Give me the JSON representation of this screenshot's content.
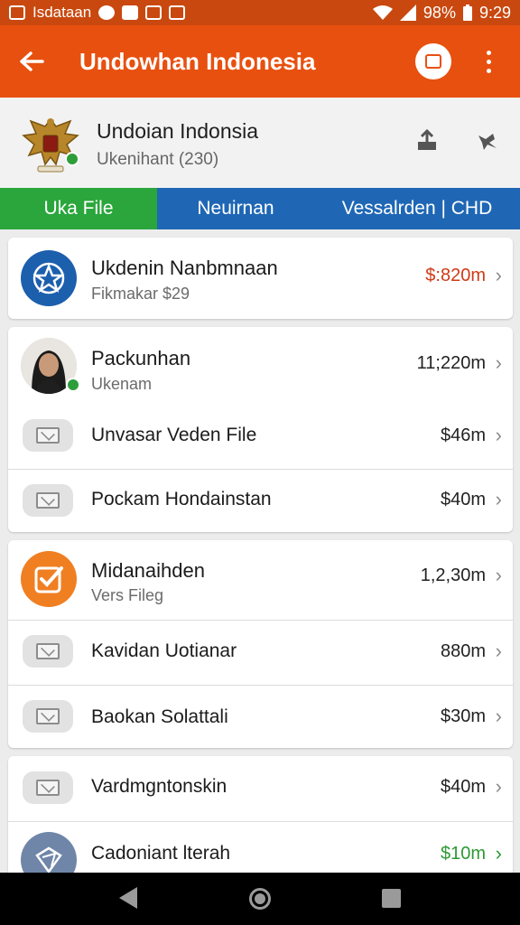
{
  "status_bar": {
    "app_label": "Isdataan",
    "battery": "98%",
    "time": "9:29"
  },
  "app_bar": {
    "title": "Undowhan Indonesia"
  },
  "profile": {
    "name": "Undoian Indonsia",
    "subtitle": "Ukenihant (230)"
  },
  "tabs": [
    {
      "label": "Uka File"
    },
    {
      "label": "Neuirnan"
    },
    {
      "label": "Vessalrden | CHD"
    }
  ],
  "cards": [
    {
      "rows": [
        {
          "title": "Ukdenin Nanbmnaan",
          "subtitle": "Fikmakar $29",
          "amount": "$:820m"
        }
      ]
    },
    {
      "rows": [
        {
          "title": "Packunhan",
          "subtitle": "Ukenam",
          "amount": "11;220m"
        },
        {
          "title": "Unvasar Veden File",
          "amount": "$46m"
        },
        {
          "title": "Pockam Hondainstan",
          "amount": "$40m"
        }
      ]
    },
    {
      "rows": [
        {
          "title": "Midanaihden",
          "subtitle": "Vers Fileg",
          "amount": "1,2,30m"
        },
        {
          "title": "Kavidan Uotianar",
          "amount": "880m"
        },
        {
          "title": "Baokan Solattali",
          "amount": "$30m"
        }
      ]
    },
    {
      "rows": [
        {
          "title": "Vardmgntonskin",
          "amount": "$40m"
        },
        {
          "title": "Cadoniant lterah",
          "amount": "$10m"
        }
      ]
    }
  ],
  "colors": {
    "status_bar": "#c9480f",
    "app_bar": "#e8500f",
    "tab_active": "#2aa63c",
    "tab_inactive": "#1f67b5",
    "amount_red": "#cf3a17",
    "amount_green": "#2c9a34"
  }
}
